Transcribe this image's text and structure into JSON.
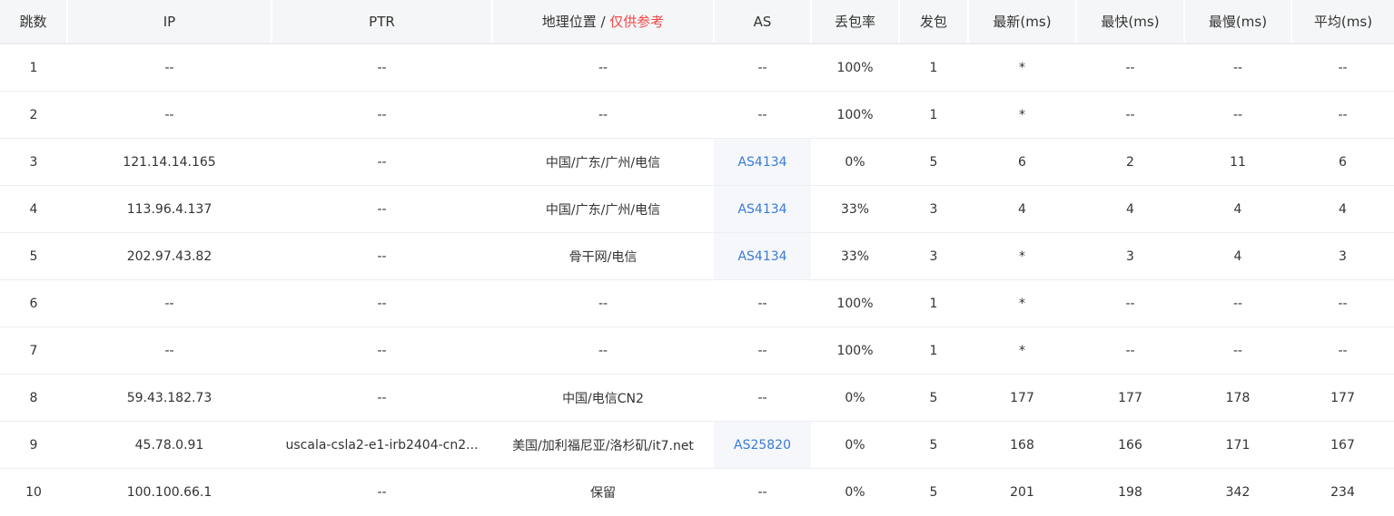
{
  "header": {
    "hop": "跳数",
    "ip": "IP",
    "ptr": "PTR",
    "geo": "地理位置",
    "geo_sep": " / ",
    "geo_note": "仅供参考",
    "as": "AS",
    "loss": "丢包率",
    "sent": "发包",
    "last": "最新(ms)",
    "best": "最快(ms)",
    "worst": "最慢(ms)",
    "avg": "平均(ms)"
  },
  "rows": [
    {
      "hop": "1",
      "ip": "--",
      "ptr": "--",
      "geo": "--",
      "as": "--",
      "as_link": false,
      "loss": "100%",
      "sent": "1",
      "last": "*",
      "best": "--",
      "worst": "--",
      "avg": "--"
    },
    {
      "hop": "2",
      "ip": "--",
      "ptr": "--",
      "geo": "--",
      "as": "--",
      "as_link": false,
      "loss": "100%",
      "sent": "1",
      "last": "*",
      "best": "--",
      "worst": "--",
      "avg": "--"
    },
    {
      "hop": "3",
      "ip": "121.14.14.165",
      "ptr": "--",
      "geo": "中国/广东/广州/电信",
      "as": "AS4134",
      "as_link": true,
      "loss": "0%",
      "sent": "5",
      "last": "6",
      "best": "2",
      "worst": "11",
      "avg": "6"
    },
    {
      "hop": "4",
      "ip": "113.96.4.137",
      "ptr": "--",
      "geo": "中国/广东/广州/电信",
      "as": "AS4134",
      "as_link": true,
      "loss": "33%",
      "sent": "3",
      "last": "4",
      "best": "4",
      "worst": "4",
      "avg": "4"
    },
    {
      "hop": "5",
      "ip": "202.97.43.82",
      "ptr": "--",
      "geo": "骨干网/电信",
      "as": "AS4134",
      "as_link": true,
      "loss": "33%",
      "sent": "3",
      "last": "*",
      "best": "3",
      "worst": "4",
      "avg": "3"
    },
    {
      "hop": "6",
      "ip": "--",
      "ptr": "--",
      "geo": "--",
      "as": "--",
      "as_link": false,
      "loss": "100%",
      "sent": "1",
      "last": "*",
      "best": "--",
      "worst": "--",
      "avg": "--"
    },
    {
      "hop": "7",
      "ip": "--",
      "ptr": "--",
      "geo": "--",
      "as": "--",
      "as_link": false,
      "loss": "100%",
      "sent": "1",
      "last": "*",
      "best": "--",
      "worst": "--",
      "avg": "--"
    },
    {
      "hop": "8",
      "ip": "59.43.182.73",
      "ptr": "--",
      "geo": "中国/电信CN2",
      "as": "--",
      "as_link": false,
      "loss": "0%",
      "sent": "5",
      "last": "177",
      "best": "177",
      "worst": "178",
      "avg": "177"
    },
    {
      "hop": "9",
      "ip": "45.78.0.91",
      "ptr": "uscala-csla2-e1-irb2404-cn2...",
      "geo": "美国/加利福尼亚/洛杉矶/it7.net",
      "as": "AS25820",
      "as_link": true,
      "loss": "0%",
      "sent": "5",
      "last": "168",
      "best": "166",
      "worst": "171",
      "avg": "167"
    },
    {
      "hop": "10",
      "ip": "100.100.66.1",
      "ptr": "--",
      "geo": "保留",
      "as": "--",
      "as_link": false,
      "loss": "0%",
      "sent": "5",
      "last": "201",
      "best": "198",
      "worst": "342",
      "avg": "234"
    }
  ],
  "colors": {
    "header_bg": "#f5f6f7",
    "geo_note": "#f04848",
    "as_link": "#3a7bd5",
    "as_cell_bg": "#f5f7fb"
  }
}
